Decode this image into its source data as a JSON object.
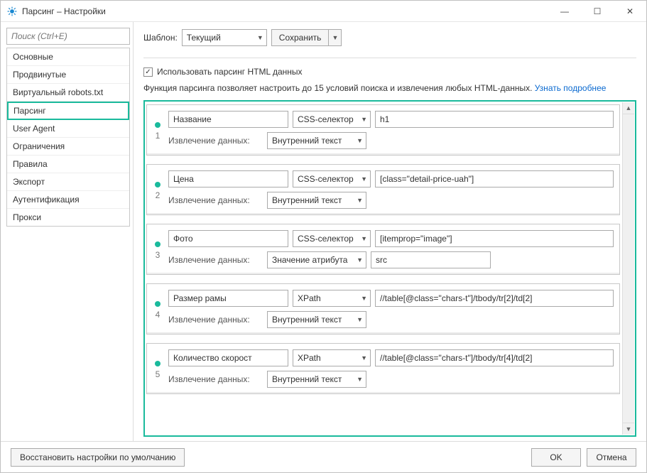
{
  "window": {
    "title": "Парсинг – Настройки"
  },
  "win_controls": {
    "min": "—",
    "max": "☐",
    "close": "✕"
  },
  "search": {
    "placeholder": "Поиск (Ctrl+E)"
  },
  "sidebar": {
    "items": [
      {
        "label": "Основные"
      },
      {
        "label": "Продвинутые"
      },
      {
        "label": "Виртуальный robots.txt"
      },
      {
        "label": "Парсинг",
        "active": true
      },
      {
        "label": "User Agent"
      },
      {
        "label": "Ограничения"
      },
      {
        "label": "Правила"
      },
      {
        "label": "Экспорт"
      },
      {
        "label": "Аутентификация"
      },
      {
        "label": "Прокси"
      }
    ]
  },
  "toolbar": {
    "template_label": "Шаблон:",
    "template_value": "Текущий",
    "save_label": "Сохранить"
  },
  "enable": {
    "checked": true,
    "label": "Использовать парсинг HTML данных"
  },
  "description": {
    "text": "Функция парсинга позволяет настроить до 15 условий поиска и извлечения любых HTML-данных. ",
    "link": "Узнать подробнее"
  },
  "extract_label": "Извлечение данных:",
  "rules": [
    {
      "num": "1",
      "name": "Название",
      "selector_type": "CSS-селектор",
      "selector_value": "h1",
      "extract_mode": "Внутренний текст",
      "extra": ""
    },
    {
      "num": "2",
      "name": "Цена",
      "selector_type": "CSS-селектор",
      "selector_value": "[class=\"detail-price-uah\"]",
      "extract_mode": "Внутренний текст",
      "extra": ""
    },
    {
      "num": "3",
      "name": "Фото",
      "selector_type": "CSS-селектор",
      "selector_value": "[itemprop=\"image\"]",
      "extract_mode": "Значение атрибута",
      "extra": "src"
    },
    {
      "num": "4",
      "name": "Размер рамы",
      "selector_type": "XPath",
      "selector_value": "//table[@class=\"chars-t\"]/tbody/tr[2]/td[2]",
      "extract_mode": "Внутренний текст",
      "extra": ""
    },
    {
      "num": "5",
      "name": "Количество скорост",
      "selector_type": "XPath",
      "selector_value": "//table[@class=\"chars-t\"]/tbody/tr[4]/td[2]",
      "extract_mode": "Внутренний текст",
      "extra": ""
    }
  ],
  "footer": {
    "reset": "Восстановить настройки по умолчанию",
    "ok": "OK",
    "cancel": "Отмена"
  }
}
